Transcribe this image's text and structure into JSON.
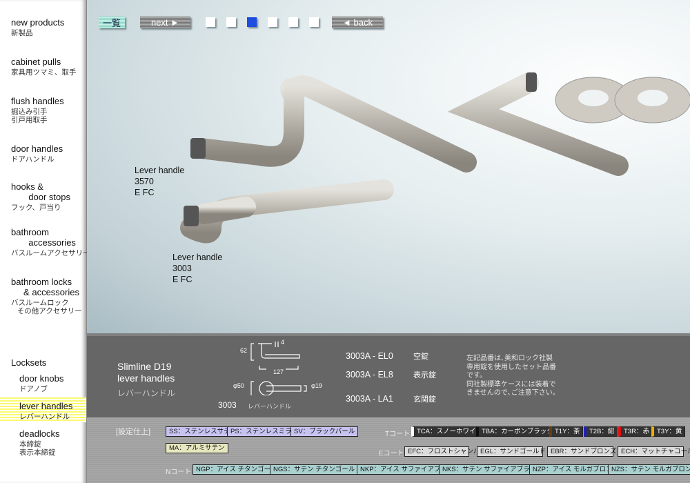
{
  "sidebar": {
    "items": [
      {
        "en": "new products",
        "jp": "新製品"
      },
      {
        "en": "cabinet pulls",
        "jp": "家具用ツマミ、取手"
      },
      {
        "en": "flush handles",
        "jp": "掘込み引手\n引戸用取手"
      },
      {
        "en": "door handles",
        "jp": "ドアハンドル"
      },
      {
        "en": "hooks &\n       door stops",
        "jp": "フック、戸当り"
      },
      {
        "en": "bathroom\n       accessories",
        "jp": "バスルームアクセサリー"
      },
      {
        "en": "bathroom locks\n     & accessories",
        "jp": "バスルームロック\n   その他アクセサリー"
      }
    ],
    "locksets_heading": "Locksets",
    "sub_items": [
      {
        "en": "door knobs",
        "jp": "ドアノブ"
      },
      {
        "en": "lever handles",
        "jp": "レバーハンドル",
        "active": true
      },
      {
        "en": "deadlocks",
        "jp": "本締錠\n表示本締錠"
      }
    ]
  },
  "toolbar": {
    "list": "一覧",
    "next": "next ►",
    "back": "◄ back",
    "pages": 6,
    "current_page": 3,
    "active_color": "#1f4de0"
  },
  "photo": {
    "labels": [
      "Lever handle\n3570\nE FC",
      "Lever handle\n3003\nE FC"
    ]
  },
  "info": {
    "title": "Slimline D19\nlever handles",
    "title_jp": "レバーハンドル",
    "dims": {
      "h": "62",
      "t": "4",
      "l": "127",
      "rose": "φ50",
      "dia": "φ19"
    },
    "model": "3003",
    "model_jp": "レバーハンドル",
    "sets": [
      {
        "code": "3003A - EL0",
        "name": "空錠"
      },
      {
        "code": "3003A - EL8",
        "name": "表示錠"
      },
      {
        "code": "3003A - LA1",
        "name": "玄関錠"
      }
    ],
    "note": "左記品番は､美和ロック社製\n専用錠を使用したセット品番\nです。\n同社製標準ケースには装着で\nきませんので､ご注意下さい。"
  },
  "finishes": {
    "heading": "[設定仕上]",
    "standard": [
      "SS：ステンレスサテン",
      "PS：ステンレスミラー",
      "SV：ブラックパール"
    ],
    "ma": "MA：アルミサテン",
    "t_label": "Tコート",
    "t": [
      {
        "t": "TCA：スノーホワイト",
        "c": "#ffffff"
      },
      {
        "t": "TBA：カーボンブラック",
        "c": "#111111"
      },
      {
        "t": "T1Y：茶",
        "c": "#6b3a10"
      },
      {
        "t": "T2B：紺",
        "c": "#2020c0"
      },
      {
        "t": "T3R：赤",
        "c": "#e01010"
      },
      {
        "t": "T3Y：黄",
        "c": "#f0b000"
      }
    ],
    "e_label": "Eコート",
    "e": [
      "EFC：フロストシャンパン",
      "EGL：サンドゴールド",
      "EBR：サンドブロンズ",
      "ECH：マットチャコール"
    ],
    "n_label": "Nコート",
    "n": [
      "NGP：アイス チタンゴールド",
      "NGS：サテン チタンゴールド",
      "NKP：アイス サファイアブラック",
      "NKS：サテン サファイアブラック",
      "NZP：アイス モルガブロンズ",
      "NZS：サテン モルガブロンズ"
    ]
  }
}
